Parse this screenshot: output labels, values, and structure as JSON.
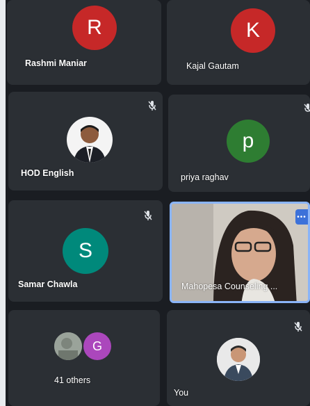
{
  "participants": [
    {
      "name": "Rashmi Maniar",
      "initial": "R",
      "avatar_color": "#c62828",
      "muted": false
    },
    {
      "name": "Kajal Gautam",
      "initial": "K",
      "avatar_color": "#c62828",
      "muted": false
    },
    {
      "name": "HOD English",
      "initial": "",
      "avatar_color": "#f5f5f5",
      "muted": true
    },
    {
      "name": "priya raghav",
      "initial": "p",
      "avatar_color": "#2e7d32",
      "muted": true
    },
    {
      "name": "Samar Chawla",
      "initial": "S",
      "avatar_color": "#00897b",
      "muted": true
    },
    {
      "name": "Mahopesa Counseling ...",
      "initial": "",
      "avatar_color": "",
      "muted": false
    },
    {
      "name": "41 others",
      "initial": "G",
      "avatar_color": "#ab47bc",
      "muted": false
    },
    {
      "name": "You",
      "initial": "",
      "avatar_color": "#f5f5f5",
      "muted": true
    }
  ],
  "active_speaker": "Mahopesa Counseling ...",
  "more_options_icon": "more-dots-icon"
}
